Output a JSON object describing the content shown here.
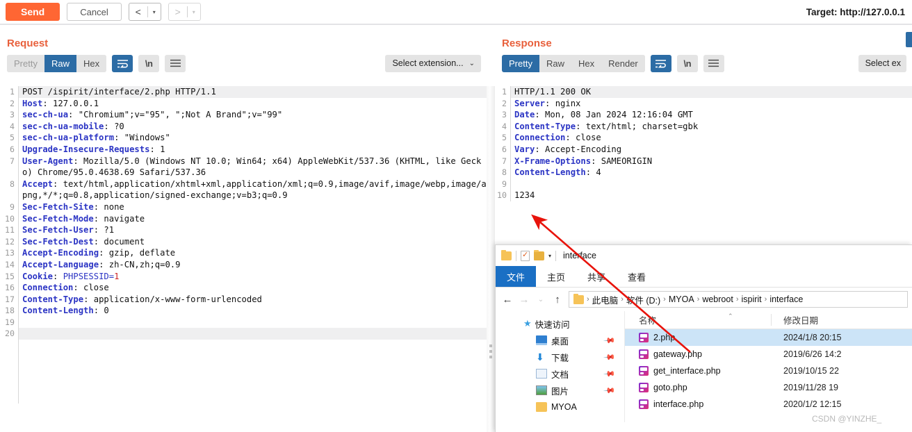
{
  "toolbar": {
    "send_label": "Send",
    "cancel_label": "Cancel",
    "back_arrow": "<",
    "forward_arrow": ">",
    "caret": "▾",
    "target_label": "Target: http://127.0.0.1"
  },
  "request": {
    "title": "Request",
    "tabs": [
      {
        "label": "Pretty",
        "state": "muted"
      },
      {
        "label": "Raw",
        "state": "active"
      },
      {
        "label": "Hex",
        "state": "normal"
      }
    ],
    "wrap_icon": "wordwrap-icon",
    "newline_label": "\\n",
    "menu_icon": "hamburger-icon",
    "select_extension": "Select extension...",
    "select_caret": "⌄",
    "lines": [
      {
        "n": "1",
        "hdr": "",
        "val": "POST /ispirit/interface/2.php HTTP/1.1",
        "hl": true
      },
      {
        "n": "2",
        "hdr": "Host",
        "val": " 127.0.0.1"
      },
      {
        "n": "3",
        "hdr": "sec-ch-ua",
        "val": " \"Chromium\";v=\"95\", \";Not A Brand\";v=\"99\""
      },
      {
        "n": "4",
        "hdr": "sec-ch-ua-mobile",
        "val": " ?0"
      },
      {
        "n": "5",
        "hdr": "sec-ch-ua-platform",
        "val": " \"Windows\""
      },
      {
        "n": "6",
        "hdr": "Upgrade-Insecure-Requests",
        "val": " 1"
      },
      {
        "n": "7",
        "hdr": "User-Agent",
        "val": " Mozilla/5.0 (Windows NT 10.0; Win64; x64) AppleWebKit/537.36 (KHTML, like Gecko) Chrome/95.0.4638.69 Safari/537.36"
      },
      {
        "n": "8",
        "hdr": "Accept",
        "val": " text/html,application/xhtml+xml,application/xml;q=0.9,image/avif,image/webp,image/apng,*/*;q=0.8,application/signed-exchange;v=b3;q=0.9"
      },
      {
        "n": "9",
        "hdr": "Sec-Fetch-Site",
        "val": " none"
      },
      {
        "n": "10",
        "hdr": "Sec-Fetch-Mode",
        "val": " navigate"
      },
      {
        "n": "11",
        "hdr": "Sec-Fetch-User",
        "val": " ?1"
      },
      {
        "n": "12",
        "hdr": "Sec-Fetch-Dest",
        "val": " document"
      },
      {
        "n": "13",
        "hdr": "Accept-Encoding",
        "val": " gzip, deflate"
      },
      {
        "n": "14",
        "hdr": "Accept-Language",
        "val": " zh-CN,zh;q=0.9"
      },
      {
        "n": "15",
        "hdr": "Cookie",
        "cookie_name": " PHPSESSID=",
        "cookie_value": "1"
      },
      {
        "n": "16",
        "hdr": "Connection",
        "val": " close"
      },
      {
        "n": "17",
        "hdr": "Content-Type",
        "val": " application/x-www-form-urlencoded"
      },
      {
        "n": "18",
        "hdr": "Content-Length",
        "val": " 0"
      },
      {
        "n": "19",
        "hdr": "",
        "val": ""
      },
      {
        "n": "20",
        "hdr": "",
        "val": "",
        "hl": true
      }
    ]
  },
  "response": {
    "title": "Response",
    "tabs": [
      {
        "label": "Pretty",
        "state": "active"
      },
      {
        "label": "Raw",
        "state": "normal"
      },
      {
        "label": "Hex",
        "state": "normal"
      },
      {
        "label": "Render",
        "state": "normal"
      }
    ],
    "newline_label": "\\n",
    "select_extension": "Select ex",
    "lines": [
      {
        "n": "1",
        "hdr": "",
        "val": "HTTP/1.1 200 OK",
        "hl": true
      },
      {
        "n": "2",
        "hdr": "Server",
        "val": " nginx"
      },
      {
        "n": "3",
        "hdr": "Date",
        "val": " Mon, 08 Jan 2024 12:16:04 GMT"
      },
      {
        "n": "4",
        "hdr": "Content-Type",
        "val": " text/html; charset=gbk"
      },
      {
        "n": "5",
        "hdr": "Connection",
        "val": " close"
      },
      {
        "n": "6",
        "hdr": "Vary",
        "val": " Accept-Encoding"
      },
      {
        "n": "7",
        "hdr": "X-Frame-Options",
        "val": " SAMEORIGIN"
      },
      {
        "n": "8",
        "hdr": "Content-Length",
        "val": " 4"
      },
      {
        "n": "9",
        "hdr": "",
        "val": ""
      },
      {
        "n": "10",
        "hdr": "",
        "val": "1234"
      }
    ]
  },
  "explorer": {
    "title": "interface",
    "quick_icons": [
      "folder-icon",
      "properties-icon",
      "new-folder-icon",
      "customize-caret-icon"
    ],
    "ribbon_tabs": [
      {
        "label": "文件",
        "active": true
      },
      {
        "label": "主页",
        "active": false
      },
      {
        "label": "共享",
        "active": false
      },
      {
        "label": "查看",
        "active": false
      }
    ],
    "nav": {
      "back": "←",
      "forward": "→",
      "recent": "⌄",
      "up": "↑"
    },
    "breadcrumb": [
      "此电脑",
      "软件 (D:)",
      "MYOA",
      "webroot",
      "ispirit",
      "interface"
    ],
    "breadcrumb_sep": "›",
    "sidebar": [
      {
        "label": "快速访问",
        "icon": "star-icon",
        "pinned": false
      },
      {
        "label": "桌面",
        "icon": "desktop-icon",
        "pinned": true
      },
      {
        "label": "下载",
        "icon": "download-icon",
        "pinned": true
      },
      {
        "label": "文档",
        "icon": "documents-icon",
        "pinned": true
      },
      {
        "label": "图片",
        "icon": "pictures-icon",
        "pinned": true
      },
      {
        "label": "MYOA",
        "icon": "folder-icon",
        "pinned": false
      }
    ],
    "columns": [
      "名称",
      "修改日期"
    ],
    "files": [
      {
        "name": "2.php",
        "date": "2024/1/8 20:15",
        "selected": true
      },
      {
        "name": "gateway.php",
        "date": "2019/6/26 14:2",
        "selected": false
      },
      {
        "name": "get_interface.php",
        "date": "2019/10/15 22",
        "selected": false
      },
      {
        "name": "goto.php",
        "date": "2019/11/28 19",
        "selected": false
      },
      {
        "name": "interface.php",
        "date": "2020/1/2 12:15",
        "selected": false
      }
    ]
  },
  "annotation": {
    "arrow_color": "#e8130b",
    "arrow_name": "red-annotation-arrow"
  },
  "watermark": {
    "text": "CSDN @YINZHE_"
  }
}
